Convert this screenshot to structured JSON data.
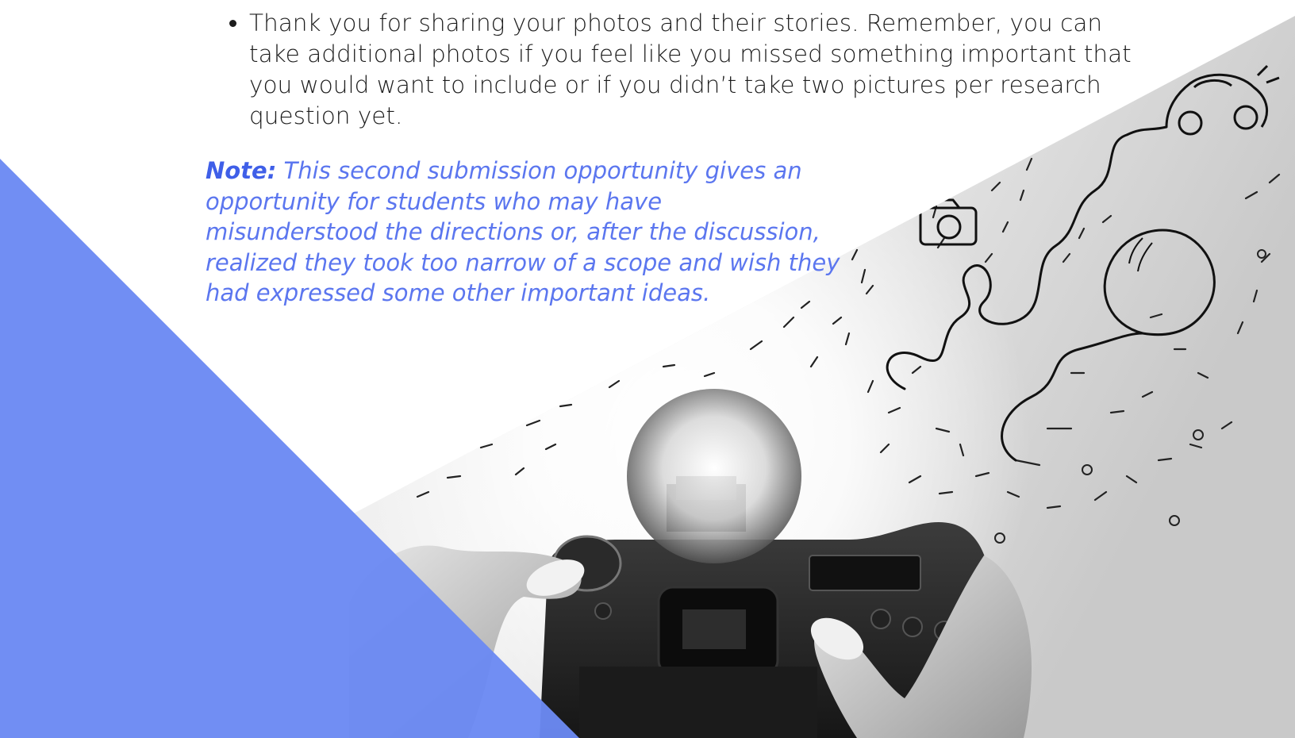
{
  "bullets": [
    "Thank you for sharing your photos and their stories. Remember, you can take additional photos if you feel like you missed something important that you would want to include or if you didn’t take two pictures per research question yet."
  ],
  "note": {
    "label": "Note:",
    "text": " This second submission opportunity gives an opportunity for students who may have misunderstood the directions or, after the discussion, realized they took too narrow of a scope and wish they had expressed some other important ideas."
  },
  "colors": {
    "accent_blue": "#5b76ef",
    "triangle_blue": "#6b89f2"
  }
}
